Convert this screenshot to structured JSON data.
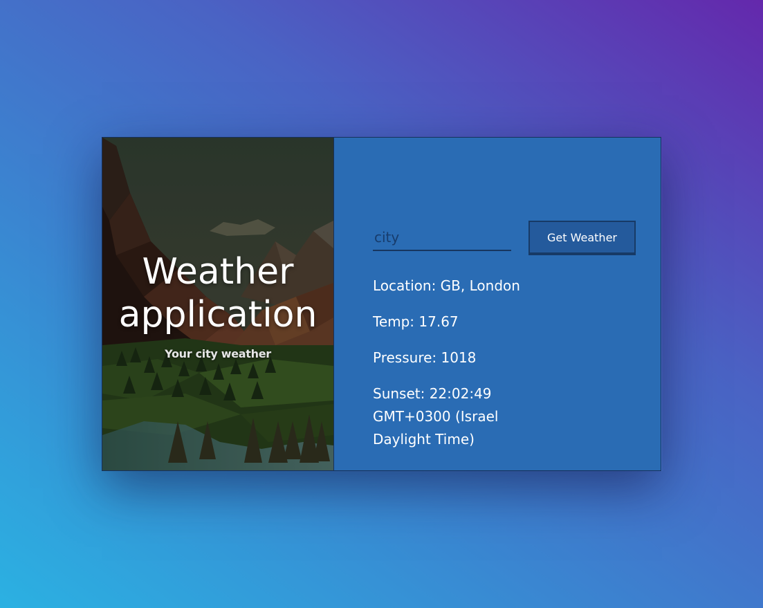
{
  "hero": {
    "title_line1": "Weather",
    "title_line2": "application",
    "subtitle": "Your city weather"
  },
  "search": {
    "value": "",
    "placeholder": "city",
    "button_label": "Get Weather"
  },
  "results": {
    "location": "Location: GB, London",
    "temp": "Temp: 17.67",
    "pressure": "Pressure: 1018",
    "sunset": "Sunset: 22:02:49 GMT+0300 (Israel Daylight Time)"
  },
  "colors": {
    "panel": "#2a6cb4",
    "button": "#245a9c",
    "border": "#16305a",
    "gradient_start": "#2bb1e2",
    "gradient_end": "#6428ac"
  }
}
